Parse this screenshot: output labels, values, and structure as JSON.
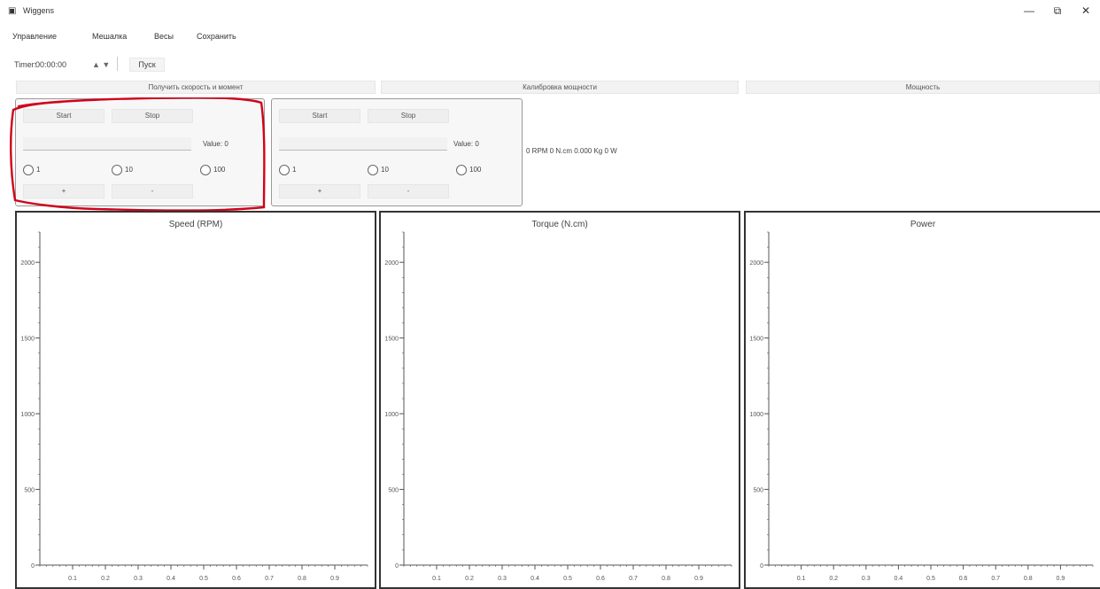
{
  "window": {
    "title": "Wiggens",
    "icon": "app-icon",
    "controls": {
      "minimize": "—",
      "restore": "⧉",
      "close": "✕"
    }
  },
  "menu": {
    "items": [
      "Управление",
      "Мешалка",
      "Весы",
      "Сохранить"
    ]
  },
  "timer": {
    "label": "Timer:",
    "value": "00:00:00",
    "spin": "▲ ▼",
    "start_label": "Пуск"
  },
  "tabs": [
    "Получить скорость и момент",
    "Калибровка мощности",
    "Мощность"
  ],
  "groups": [
    {
      "start_label": "Start",
      "stop_label": "Stop",
      "value_label": "Value: 0",
      "radios": [
        "1",
        "10",
        "100"
      ],
      "plus_label": "+",
      "minus_label": "-"
    },
    {
      "start_label": "Start",
      "stop_label": "Stop",
      "value_label": "Value: 0",
      "radios": [
        "1",
        "10",
        "100"
      ],
      "plus_label": "+",
      "minus_label": "-"
    }
  ],
  "readout": "0 RPM  0 N.cm  0.000 Kg  0 W",
  "chart_data": [
    {
      "type": "line",
      "title": "Speed (RPM)",
      "xlabel": "",
      "ylabel": "",
      "ylim": [
        0,
        2200
      ],
      "xlim": [
        0,
        1
      ],
      "yticks": [
        0,
        500,
        1000,
        1500,
        2000
      ],
      "xticks": [
        0.1,
        0.2,
        0.3,
        0.4,
        0.5,
        0.6,
        0.7,
        0.8,
        0.9
      ],
      "series": []
    },
    {
      "type": "line",
      "title": "Torque (N.cm)",
      "xlabel": "",
      "ylabel": "",
      "ylim": [
        0,
        2200
      ],
      "xlim": [
        0,
        1
      ],
      "yticks": [
        0,
        500,
        1000,
        1500,
        2000
      ],
      "xticks": [
        0.1,
        0.2,
        0.3,
        0.4,
        0.5,
        0.6,
        0.7,
        0.8,
        0.9
      ],
      "series": []
    },
    {
      "type": "line",
      "title": "Power",
      "xlabel": "",
      "ylabel": "",
      "ylim": [
        0,
        2200
      ],
      "xlim": [
        0,
        1
      ],
      "yticks": [
        0,
        500,
        1000,
        1500,
        2000
      ],
      "xticks": [
        0.1,
        0.2,
        0.3,
        0.4,
        0.5,
        0.6,
        0.7,
        0.8,
        0.9
      ],
      "series": []
    }
  ],
  "colors": {
    "annotation": "#d0021b",
    "panel_border": "#333333",
    "axis": "#555555"
  }
}
